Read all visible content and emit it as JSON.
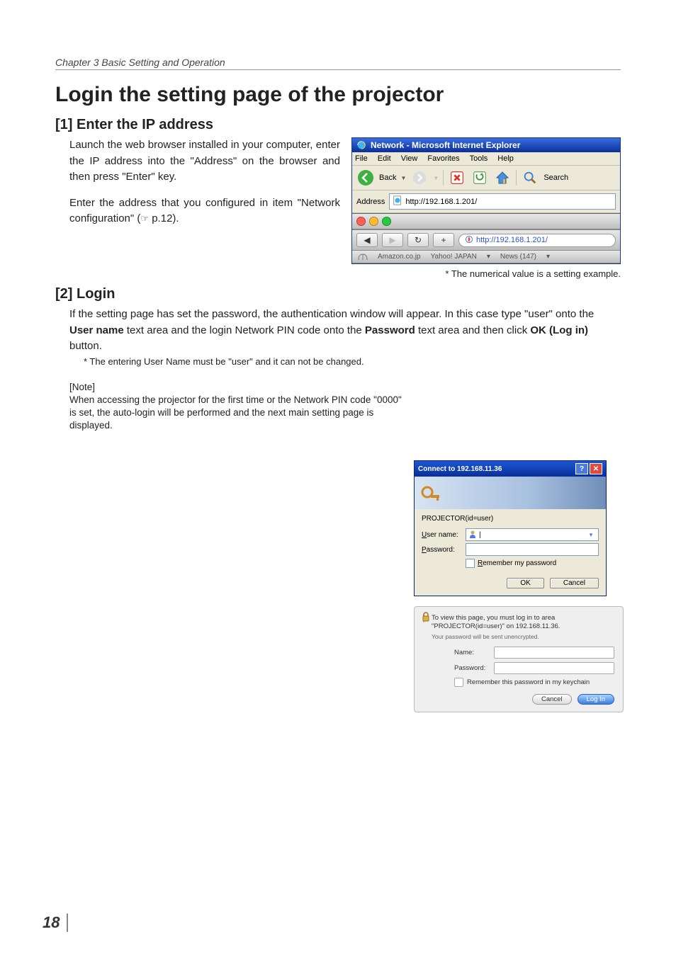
{
  "chapter": "Chapter 3 Basic Setting and Operation",
  "title": "Login the setting page of the projector",
  "s1": {
    "heading": "[1] Enter the IP address",
    "p1": "Launch the web browser installed in your computer, enter the IP address into the \"Address\" on the browser and then press \"Enter\" key.",
    "p2a": "Enter the address that you configured in item \"Network configuration\" (",
    "p2b": " p.12).",
    "pointer": "☞"
  },
  "ie": {
    "title": "Network - Microsoft Internet Explorer",
    "menu": [
      "File",
      "Edit",
      "View",
      "Favorites",
      "Tools",
      "Help"
    ],
    "back": "Back",
    "search": "Search",
    "addr_label": "Address",
    "addr_value": "http://192.168.1.201/"
  },
  "safari": {
    "reload": "↻",
    "plus": "+",
    "url": "http://192.168.1.201/",
    "bookmarks": [
      "Amazon.co.jp",
      "Yahoo! JAPAN",
      "News (147)"
    ],
    "bm_arrow": "▾"
  },
  "caption1": "* The numerical value is a setting example.",
  "s2": {
    "heading": "[2] Login",
    "p_a": "If the setting page has set the password, the authentication window will appear. In this case type \"user\" onto the ",
    "p_b": "User name",
    "p_c": " text area and the login Network PIN code onto the ",
    "p_d": "Password",
    "p_e": " text area and then click ",
    "p_f": "OK (Log in)",
    "p_g": " button.",
    "note_star": "* The entering User Name must be \"user\" and it can not be changed.",
    "note_head": "[Note]",
    "note_body": "When accessing the projector for the first time or the Network PIN code \"0000\" is set, the auto-login will be performed and the next main setting page is displayed."
  },
  "win_dlg": {
    "title": "Connect to 192.168.11.36",
    "realm": "PROJECTOR(id=user)",
    "lbl_user_u": "U",
    "lbl_user_rest": "ser name:",
    "lbl_pass_u": "P",
    "lbl_pass_rest": "assword:",
    "remember_u": "R",
    "remember_rest": "emember my password",
    "ok": "OK",
    "cancel": "Cancel",
    "help": "?",
    "close": "✕",
    "cursor": "|"
  },
  "mac_dlg": {
    "msg1a": "To view this page, you must log in to area \"PROJECTOR(id=user)\" on 192.168.11.36.",
    "msg2": "Your password will be sent unencrypted.",
    "lbl_name": "Name:",
    "lbl_pass": "Password:",
    "remember": "Remember this password in my keychain",
    "cancel": "Cancel",
    "login": "Log In"
  },
  "page_number": "18"
}
